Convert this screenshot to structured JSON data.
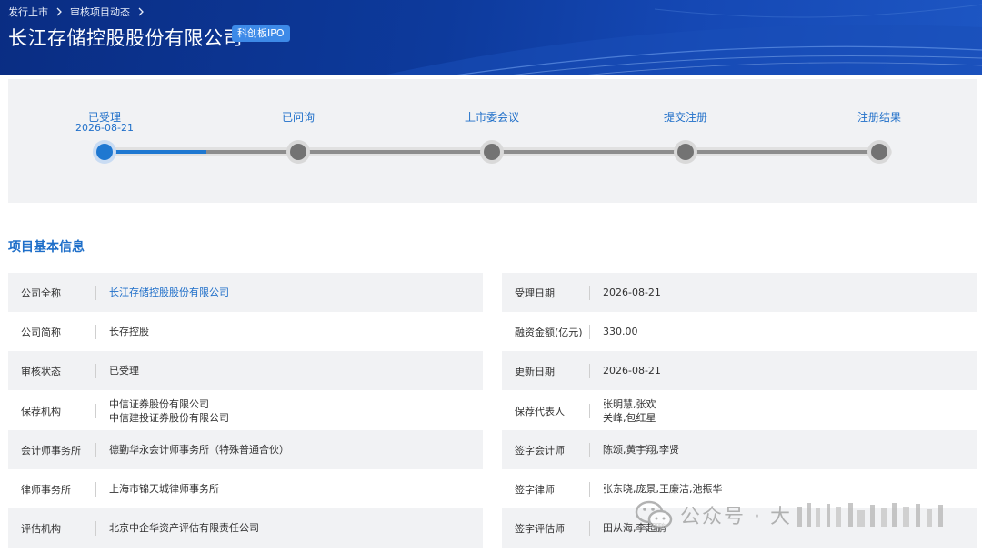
{
  "breadcrumb": {
    "items": [
      "发行上市",
      "审核项目动态"
    ]
  },
  "header": {
    "company_title": "长江存储控股股份有限公司",
    "board_badge": "科创板IPO"
  },
  "progress": {
    "completed_fraction": 0.125,
    "steps": [
      {
        "label": "已受理",
        "date": "2026-08-21",
        "active": true
      },
      {
        "label": "已问询",
        "date": "",
        "active": false
      },
      {
        "label": "上市委会议",
        "date": "",
        "active": false
      },
      {
        "label": "提交注册",
        "date": "",
        "active": false
      },
      {
        "label": "注册结果",
        "date": "",
        "active": false
      }
    ]
  },
  "section": {
    "title": "项目基本信息"
  },
  "info_left": [
    {
      "label": "公司全称",
      "value": [
        "长江存储控股股份有限公司"
      ],
      "link": true
    },
    {
      "label": "公司简称",
      "value": [
        "长存控股"
      ],
      "link": false
    },
    {
      "label": "审核状态",
      "value": [
        "已受理"
      ],
      "link": false
    },
    {
      "label": "保荐机构",
      "value": [
        "中信证券股份有限公司",
        "中信建投证券股份有限公司"
      ],
      "link": false
    },
    {
      "label": "会计师事务所",
      "value": [
        "德勤华永会计师事务所（特殊普通合伙）"
      ],
      "link": false
    },
    {
      "label": "律师事务所",
      "value": [
        "上海市锦天城律师事务所"
      ],
      "link": false
    },
    {
      "label": "评估机构",
      "value": [
        "北京中企华资产评估有限责任公司"
      ],
      "link": false
    }
  ],
  "info_right": [
    {
      "label": "受理日期",
      "value": [
        "2026-08-21"
      ]
    },
    {
      "label": "融资金额(亿元)",
      "value": [
        "330.00"
      ]
    },
    {
      "label": "更新日期",
      "value": [
        "2026-08-21"
      ]
    },
    {
      "label": "保荐代表人",
      "value": [
        "张明慧,张欢",
        "关峰,包红星"
      ]
    },
    {
      "label": "签字会计师",
      "value": [
        "陈颂,黄宇翔,李贤"
      ]
    },
    {
      "label": "签字律师",
      "value": [
        "张东晓,庞景,王廉洁,池振华"
      ]
    },
    {
      "label": "签字评估师",
      "value": [
        "田从海,李超鹏"
      ]
    }
  ],
  "watermark": {
    "text": "公众号 · 大",
    "icon": "wechat-icon"
  },
  "colors": {
    "banner": "#0d3a9c",
    "accent": "#1f6fc9",
    "badge": "#3d8ae8",
    "panel": "#f1f2f4"
  }
}
